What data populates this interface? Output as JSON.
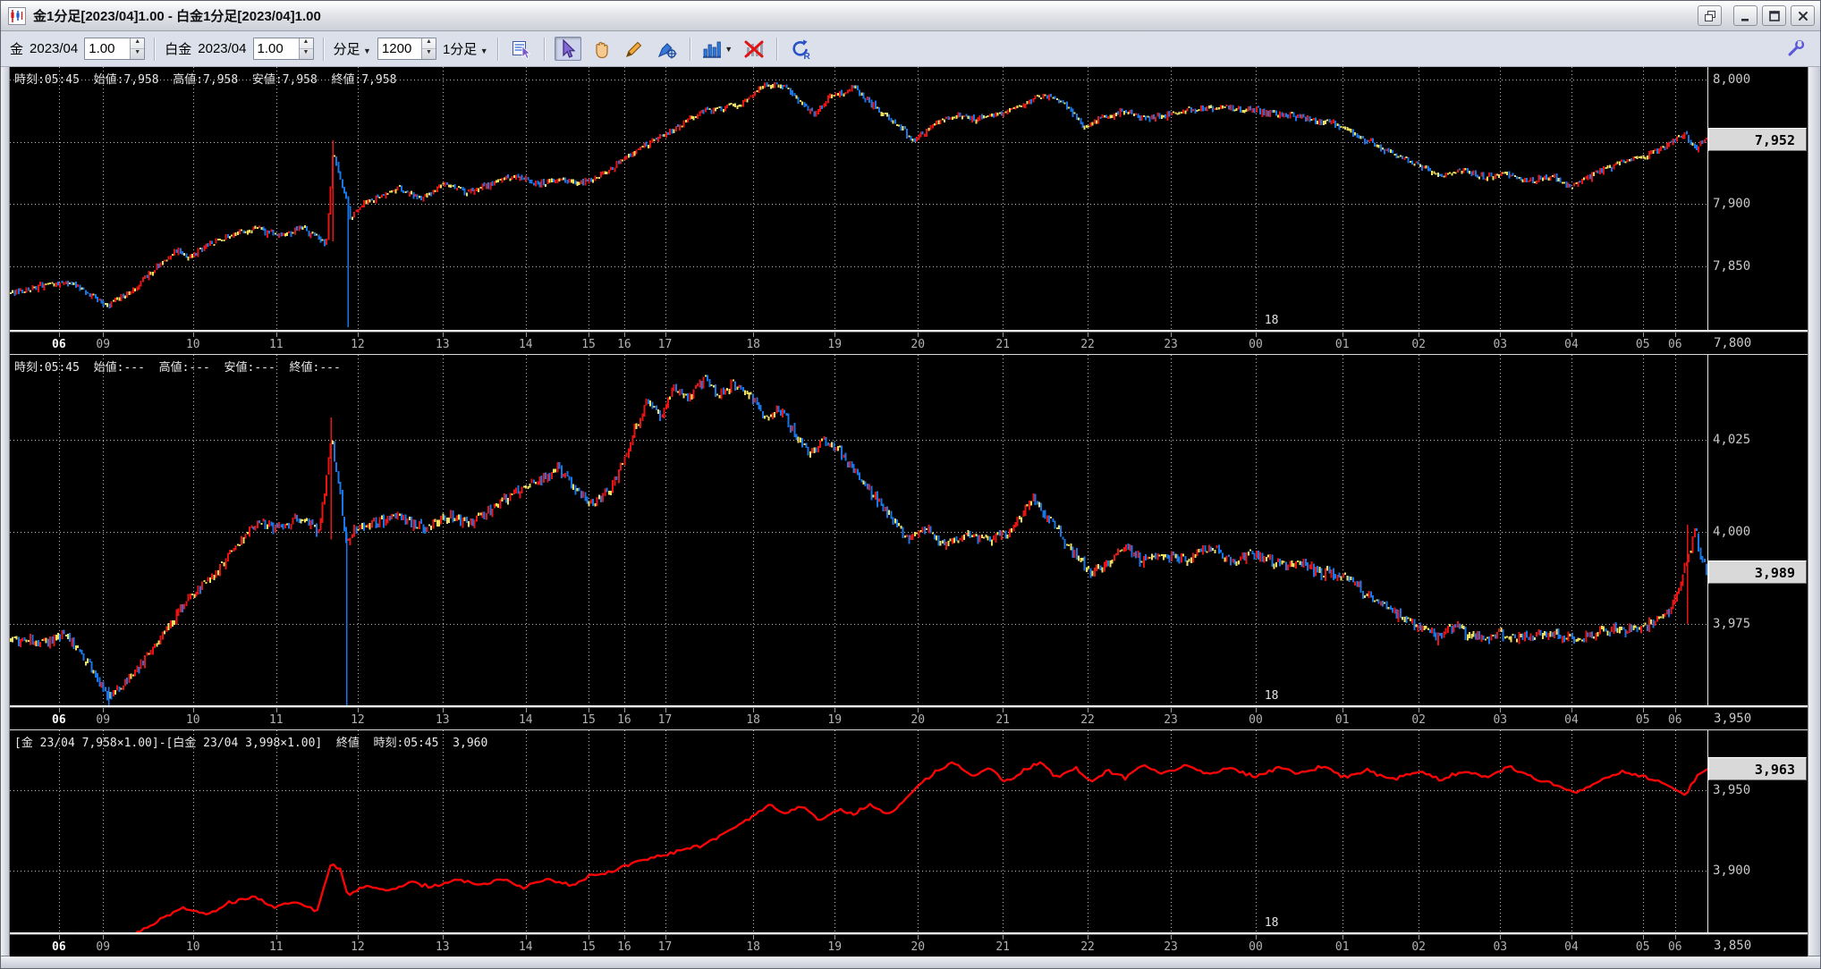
{
  "window": {
    "title": "金1分足[2023/04]1.00 - 白金1分足[2023/04]1.00",
    "controls": {
      "minimize": "–",
      "maximize": "□",
      "close": "×"
    }
  },
  "icons": {
    "app": "candlestick-mini-chart",
    "popout": "overlapping-windows",
    "board_select": "chart-board-with-cursor",
    "select": "arrow-cursor",
    "pan": "hand",
    "draw": "pencil",
    "marker": "pen-with-crosshair",
    "chart_type": "blue-bar-chart",
    "clear_drawings": "bars-with-red-x",
    "refresh": "circular-arrow-R",
    "settings": "wrench"
  },
  "toolbar": {
    "gold": {
      "label": "金",
      "month": "2023/04",
      "multiplier": "1.00"
    },
    "platinum": {
      "label": "白金",
      "month": "2023/04",
      "multiplier": "1.00"
    },
    "bars": {
      "type_label": "分足",
      "count": "1200",
      "interval_label": "1分足"
    }
  },
  "x_axis": {
    "day_label": {
      "text": "18",
      "f": 0.737
    },
    "labels": [
      {
        "t": "06",
        "f": 0.029
      },
      {
        "t": "09",
        "f": 0.055
      },
      {
        "t": "10",
        "f": 0.108
      },
      {
        "t": "11",
        "f": 0.157
      },
      {
        "t": "12",
        "f": 0.205
      },
      {
        "t": "13",
        "f": 0.255
      },
      {
        "t": "14",
        "f": 0.304
      },
      {
        "t": "15",
        "f": 0.341
      },
      {
        "t": "16",
        "f": 0.362
      },
      {
        "t": "17",
        "f": 0.386
      },
      {
        "t": "18",
        "f": 0.438
      },
      {
        "t": "19",
        "f": 0.486
      },
      {
        "t": "20",
        "f": 0.535
      },
      {
        "t": "21",
        "f": 0.585
      },
      {
        "t": "22",
        "f": 0.635
      },
      {
        "t": "23",
        "f": 0.684
      },
      {
        "t": "00",
        "f": 0.734
      },
      {
        "t": "01",
        "f": 0.785
      },
      {
        "t": "02",
        "f": 0.83
      },
      {
        "t": "03",
        "f": 0.878
      },
      {
        "t": "04",
        "f": 0.92
      },
      {
        "t": "05",
        "f": 0.962
      },
      {
        "t": "06",
        "f": 0.981
      }
    ]
  },
  "chart_data": [
    {
      "type": "candlestick",
      "name": "金 1分足 2023/04",
      "info": "時刻:05:45  始値:7,958  高値:7,958  安値:7,958  終値:7,958",
      "up_color": "#e81414",
      "down_color": "#1876e8",
      "flat_color": "#eee060",
      "y_axis": {
        "min": 7799,
        "max": 8010,
        "gridlines": [
          8000,
          7950,
          7900,
          7850
        ],
        "labels": [
          {
            "value": 8000,
            "text": "8,000"
          },
          {
            "value": 7900,
            "text": "7,900"
          },
          {
            "value": 7850,
            "text": "7,850"
          }
        ],
        "edge_label": "7,800"
      },
      "last": {
        "value": 7952,
        "text": "7,952"
      },
      "wicks": [
        {
          "f": 0.19,
          "top": 7951,
          "bottom": 7870,
          "dir": "up"
        },
        {
          "f": 0.199,
          "top": 7905,
          "bottom": 7801,
          "dir": "down"
        }
      ],
      "series": [
        [
          0.001,
          7829
        ],
        [
          0.018,
          7834
        ],
        [
          0.032,
          7838
        ],
        [
          0.045,
          7829
        ],
        [
          0.058,
          7819
        ],
        [
          0.072,
          7831
        ],
        [
          0.089,
          7854
        ],
        [
          0.099,
          7863
        ],
        [
          0.105,
          7857
        ],
        [
          0.119,
          7869
        ],
        [
          0.132,
          7877
        ],
        [
          0.146,
          7880
        ],
        [
          0.159,
          7874
        ],
        [
          0.172,
          7881
        ],
        [
          0.181,
          7873
        ],
        [
          0.186,
          7866
        ],
        [
          0.19,
          7942
        ],
        [
          0.194,
          7922
        ],
        [
          0.197,
          7908
        ],
        [
          0.201,
          7886
        ],
        [
          0.206,
          7900
        ],
        [
          0.216,
          7905
        ],
        [
          0.229,
          7912
        ],
        [
          0.243,
          7905
        ],
        [
          0.256,
          7916
        ],
        [
          0.27,
          7909
        ],
        [
          0.283,
          7916
        ],
        [
          0.297,
          7923
        ],
        [
          0.31,
          7916
        ],
        [
          0.323,
          7920
        ],
        [
          0.337,
          7916
        ],
        [
          0.347,
          7923
        ],
        [
          0.36,
          7934
        ],
        [
          0.37,
          7945
        ],
        [
          0.38,
          7951
        ],
        [
          0.39,
          7959
        ],
        [
          0.403,
          7972
        ],
        [
          0.417,
          7977
        ],
        [
          0.43,
          7981
        ],
        [
          0.443,
          7993
        ],
        [
          0.453,
          7998
        ],
        [
          0.463,
          7986
        ],
        [
          0.473,
          7972
        ],
        [
          0.483,
          7986
        ],
        [
          0.497,
          7993
        ],
        [
          0.507,
          7981
        ],
        [
          0.517,
          7969
        ],
        [
          0.527,
          7959
        ],
        [
          0.533,
          7950
        ],
        [
          0.543,
          7964
        ],
        [
          0.557,
          7972
        ],
        [
          0.57,
          7968
        ],
        [
          0.583,
          7972
        ],
        [
          0.597,
          7981
        ],
        [
          0.61,
          7987
        ],
        [
          0.623,
          7979
        ],
        [
          0.633,
          7961
        ],
        [
          0.643,
          7969
        ],
        [
          0.657,
          7975
        ],
        [
          0.67,
          7969
        ],
        [
          0.683,
          7972
        ],
        [
          0.7,
          7976
        ],
        [
          0.717,
          7978
        ],
        [
          0.733,
          7975
        ],
        [
          0.75,
          7972
        ],
        [
          0.767,
          7968
        ],
        [
          0.783,
          7964
        ],
        [
          0.8,
          7951
        ],
        [
          0.813,
          7942
        ],
        [
          0.83,
          7931
        ],
        [
          0.843,
          7923
        ],
        [
          0.857,
          7927
        ],
        [
          0.87,
          7921
        ],
        [
          0.88,
          7925
        ],
        [
          0.897,
          7918
        ],
        [
          0.91,
          7923
        ],
        [
          0.92,
          7912
        ],
        [
          0.93,
          7921
        ],
        [
          0.943,
          7929
        ],
        [
          0.957,
          7936
        ],
        [
          0.97,
          7942
        ],
        [
          0.98,
          7950
        ],
        [
          0.987,
          7957
        ],
        [
          0.993,
          7945
        ],
        [
          1.0,
          7952
        ]
      ]
    },
    {
      "type": "candlestick",
      "name": "白金 1分足 2023/04",
      "info": "時刻:05:45  始値:---  高値:---  安値:---  終値:---",
      "up_color": "#e81414",
      "down_color": "#1876e8",
      "flat_color": "#eee060",
      "y_axis": {
        "min": 3953,
        "max": 4048,
        "gridlines": [
          4025,
          4000,
          3975
        ],
        "labels": [
          {
            "value": 4025,
            "text": "4,025"
          },
          {
            "value": 4000,
            "text": "4,000"
          },
          {
            "value": 3975,
            "text": "3,975"
          }
        ],
        "edge_label": "3,950"
      },
      "last": {
        "value": 3989,
        "text": "3,989"
      },
      "wicks": [
        {
          "f": 0.058,
          "top": 3958,
          "bottom": 3944,
          "dir": "down"
        },
        {
          "f": 0.189,
          "top": 4031,
          "bottom": 3998,
          "dir": "up"
        },
        {
          "f": 0.198,
          "top": 4000,
          "bottom": 3939,
          "dir": "down"
        },
        {
          "f": 0.988,
          "top": 4002,
          "bottom": 3975,
          "dir": "up"
        }
      ],
      "series": [
        [
          0.001,
          3971
        ],
        [
          0.018,
          3970
        ],
        [
          0.032,
          3972
        ],
        [
          0.045,
          3965
        ],
        [
          0.058,
          3955
        ],
        [
          0.072,
          3961
        ],
        [
          0.089,
          3972
        ],
        [
          0.102,
          3980
        ],
        [
          0.119,
          3988
        ],
        [
          0.132,
          3996
        ],
        [
          0.146,
          4003
        ],
        [
          0.159,
          4001
        ],
        [
          0.172,
          4004
        ],
        [
          0.182,
          3999
        ],
        [
          0.189,
          4025
        ],
        [
          0.194,
          4012
        ],
        [
          0.198,
          3996
        ],
        [
          0.203,
          4001
        ],
        [
          0.216,
          4003
        ],
        [
          0.229,
          4004
        ],
        [
          0.243,
          4001
        ],
        [
          0.256,
          4004
        ],
        [
          0.27,
          4003
        ],
        [
          0.283,
          4006
        ],
        [
          0.297,
          4011
        ],
        [
          0.31,
          4014
        ],
        [
          0.323,
          4017
        ],
        [
          0.333,
          4012
        ],
        [
          0.343,
          4008
        ],
        [
          0.353,
          4011
        ],
        [
          0.361,
          4019
        ],
        [
          0.368,
          4028
        ],
        [
          0.376,
          4036
        ],
        [
          0.383,
          4031
        ],
        [
          0.391,
          4039
        ],
        [
          0.4,
          4036
        ],
        [
          0.408,
          4042
        ],
        [
          0.417,
          4037
        ],
        [
          0.427,
          4040
        ],
        [
          0.437,
          4036
        ],
        [
          0.445,
          4031
        ],
        [
          0.453,
          4033
        ],
        [
          0.463,
          4027
        ],
        [
          0.471,
          4021
        ],
        [
          0.48,
          4025
        ],
        [
          0.49,
          4021
        ],
        [
          0.5,
          4015
        ],
        [
          0.51,
          4009
        ],
        [
          0.52,
          4003
        ],
        [
          0.53,
          3998
        ],
        [
          0.54,
          4001
        ],
        [
          0.55,
          3996
        ],
        [
          0.563,
          3999
        ],
        [
          0.577,
          3998
        ],
        [
          0.59,
          4001
        ],
        [
          0.603,
          4008
        ],
        [
          0.613,
          4003
        ],
        [
          0.627,
          3994
        ],
        [
          0.637,
          3989
        ],
        [
          0.647,
          3992
        ],
        [
          0.657,
          3996
        ],
        [
          0.667,
          3992
        ],
        [
          0.68,
          3994
        ],
        [
          0.693,
          3992
        ],
        [
          0.707,
          3996
        ],
        [
          0.72,
          3992
        ],
        [
          0.733,
          3994
        ],
        [
          0.747,
          3991
        ],
        [
          0.76,
          3992
        ],
        [
          0.773,
          3989
        ],
        [
          0.787,
          3988
        ],
        [
          0.8,
          3983
        ],
        [
          0.813,
          3979
        ],
        [
          0.827,
          3975
        ],
        [
          0.84,
          3972
        ],
        [
          0.853,
          3974
        ],
        [
          0.867,
          3971
        ],
        [
          0.88,
          3972
        ],
        [
          0.897,
          3971
        ],
        [
          0.913,
          3972
        ],
        [
          0.927,
          3971
        ],
        [
          0.94,
          3974
        ],
        [
          0.953,
          3973
        ],
        [
          0.967,
          3975
        ],
        [
          0.979,
          3979
        ],
        [
          0.987,
          3989
        ],
        [
          0.993,
          4000
        ],
        [
          1.0,
          3989
        ]
      ]
    },
    {
      "type": "line",
      "name": "スプレッド 金-白金",
      "info": "[金 23/04 7,958×1.00]-[白金 23/04 3,998×1.00]  終値  時刻:05:45  3,960",
      "color": "#f60606",
      "y_axis": {
        "min": 3862,
        "max": 3987,
        "gridlines": [
          3950,
          3900
        ],
        "labels": [
          {
            "value": 3950,
            "text": "3,950"
          },
          {
            "value": 3900,
            "text": "3,900"
          }
        ],
        "edge_label": "3,850"
      },
      "last": {
        "value": 3963,
        "text": "3,963"
      },
      "series": [
        [
          0.001,
          3854
        ],
        [
          0.015,
          3859
        ],
        [
          0.028,
          3854
        ],
        [
          0.038,
          3861
        ],
        [
          0.048,
          3855
        ],
        [
          0.058,
          3851
        ],
        [
          0.072,
          3859
        ],
        [
          0.089,
          3870
        ],
        [
          0.102,
          3877
        ],
        [
          0.115,
          3873
        ],
        [
          0.129,
          3880
        ],
        [
          0.143,
          3884
        ],
        [
          0.156,
          3878
        ],
        [
          0.169,
          3880
        ],
        [
          0.181,
          3875
        ],
        [
          0.189,
          3904
        ],
        [
          0.195,
          3900
        ],
        [
          0.199,
          3886
        ],
        [
          0.209,
          3891
        ],
        [
          0.223,
          3888
        ],
        [
          0.236,
          3893
        ],
        [
          0.25,
          3890
        ],
        [
          0.263,
          3895
        ],
        [
          0.277,
          3891
        ],
        [
          0.29,
          3895
        ],
        [
          0.303,
          3890
        ],
        [
          0.317,
          3895
        ],
        [
          0.33,
          3891
        ],
        [
          0.343,
          3897
        ],
        [
          0.356,
          3900
        ],
        [
          0.37,
          3906
        ],
        [
          0.383,
          3909
        ],
        [
          0.396,
          3913
        ],
        [
          0.41,
          3917
        ],
        [
          0.423,
          3924
        ],
        [
          0.437,
          3933
        ],
        [
          0.447,
          3941
        ],
        [
          0.457,
          3935
        ],
        [
          0.467,
          3941
        ],
        [
          0.477,
          3931
        ],
        [
          0.487,
          3938
        ],
        [
          0.497,
          3935
        ],
        [
          0.507,
          3941
        ],
        [
          0.517,
          3935
        ],
        [
          0.527,
          3943
        ],
        [
          0.537,
          3955
        ],
        [
          0.547,
          3962
        ],
        [
          0.557,
          3967
        ],
        [
          0.567,
          3958
        ],
        [
          0.577,
          3964
        ],
        [
          0.587,
          3955
        ],
        [
          0.597,
          3962
        ],
        [
          0.607,
          3967
        ],
        [
          0.617,
          3958
        ],
        [
          0.627,
          3964
        ],
        [
          0.637,
          3955
        ],
        [
          0.647,
          3962
        ],
        [
          0.657,
          3958
        ],
        [
          0.667,
          3965
        ],
        [
          0.68,
          3960
        ],
        [
          0.693,
          3965
        ],
        [
          0.707,
          3960
        ],
        [
          0.72,
          3964
        ],
        [
          0.733,
          3958
        ],
        [
          0.747,
          3964
        ],
        [
          0.76,
          3960
        ],
        [
          0.773,
          3965
        ],
        [
          0.787,
          3958
        ],
        [
          0.8,
          3962
        ],
        [
          0.813,
          3956
        ],
        [
          0.83,
          3962
        ],
        [
          0.843,
          3956
        ],
        [
          0.857,
          3962
        ],
        [
          0.87,
          3958
        ],
        [
          0.883,
          3964
        ],
        [
          0.897,
          3958
        ],
        [
          0.91,
          3953
        ],
        [
          0.923,
          3948
        ],
        [
          0.937,
          3956
        ],
        [
          0.95,
          3962
        ],
        [
          0.963,
          3958
        ],
        [
          0.977,
          3953
        ],
        [
          0.987,
          3946
        ],
        [
          0.993,
          3958
        ],
        [
          1.0,
          3963
        ]
      ]
    }
  ]
}
